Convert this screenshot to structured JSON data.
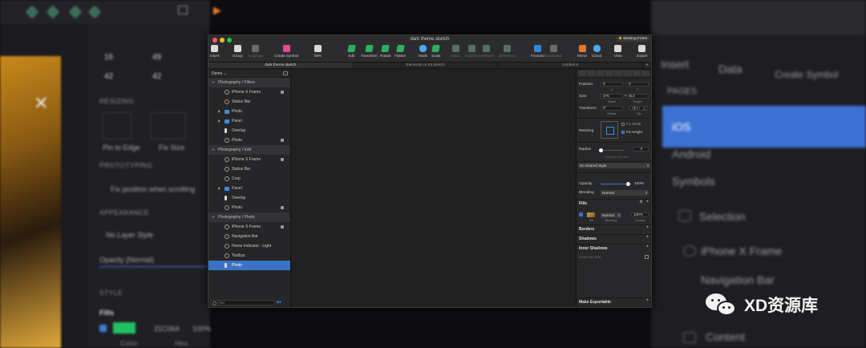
{
  "background_left": {
    "position_x": "16",
    "position_y": "49",
    "size_w": "42",
    "size_h": "42",
    "resizing_label": "RESIZING",
    "pin_to_edge": "Pin to Edge",
    "fix_size": "Fix Size",
    "prototyping_label": "PROTOTYPING",
    "fix_position": "Fix position when scrolling",
    "appearance_label": "APPEARANCE",
    "no_layer_style": "No Layer Style",
    "opacity_label": "Opacity (Normal)",
    "style_label": "STYLE",
    "fills_label": "Fills",
    "hex_value": "21C064",
    "opacity_value": "100%",
    "color_label": "Color",
    "hex_label": "Hex",
    "opacity_sub": "Opacity"
  },
  "background_right": {
    "insert": "Insert",
    "data": "Data",
    "create_symbol": "Create Symbol",
    "pages_label": "PAGES",
    "ios": "iOS",
    "android": "Android",
    "symbols": "Symbols",
    "selection": "Selection",
    "iphone_frame": "iPhone X Frame",
    "navigation_bar": "Navigation Bar",
    "content": "Content"
  },
  "watermark": "XD资源库",
  "window": {
    "title": "dark theme.sketch",
    "missing_fonts": "Missing Fonts",
    "toolbar": [
      {
        "label": "Insert",
        "icon": "plus-icon",
        "dim": false
      },
      {
        "label": "Group",
        "icon": "group-icon",
        "dim": false
      },
      {
        "label": "Ungroup",
        "icon": "ungroup-icon",
        "dim": true
      },
      {
        "label": "Create Symbol",
        "icon": "symbol-icon",
        "dim": false
      },
      {
        "label": "59%",
        "icon": "zoom-icon",
        "dim": false
      },
      {
        "label": "Edit",
        "icon": "edit-icon",
        "dim": false
      },
      {
        "label": "Transform",
        "icon": "transform-icon",
        "dim": false
      },
      {
        "label": "Rotate",
        "icon": "rotate-icon",
        "dim": false
      },
      {
        "label": "Flatten",
        "icon": "flatten-icon",
        "dim": false
      },
      {
        "label": "Mask",
        "icon": "mask-icon",
        "dim": false
      },
      {
        "label": "Scale",
        "icon": "scale-icon",
        "dim": false
      },
      {
        "label": "Union",
        "icon": "union-icon",
        "dim": true
      },
      {
        "label": "Subtract",
        "icon": "subtract-icon",
        "dim": true
      },
      {
        "label": "Intersect",
        "icon": "intersect-icon",
        "dim": true
      },
      {
        "label": "Difference",
        "icon": "difference-icon",
        "dim": true
      },
      {
        "label": "Forward",
        "icon": "forward-icon",
        "dim": false
      },
      {
        "label": "Backward",
        "icon": "backward-icon",
        "dim": true
      },
      {
        "label": "Mirror",
        "icon": "mirror-icon",
        "dim": false
      },
      {
        "label": "Cloud",
        "icon": "cloud-icon",
        "dim": false
      },
      {
        "label": "View",
        "icon": "view-icon",
        "dim": false
      },
      {
        "label": "Export",
        "icon": "export-icon",
        "dim": false
      }
    ],
    "tabs": [
      {
        "label": "dark theme.sketch",
        "active": true
      },
      {
        "label": "Elements UI Kit.sketch",
        "active": false
      },
      {
        "label": "Untitled 6",
        "active": false
      }
    ],
    "page_selector": "Demo",
    "layers": [
      {
        "type": "group",
        "label": "Photography / Filters"
      },
      {
        "type": "item",
        "icon": "sym",
        "label": "iPhone X Frame",
        "locked": true
      },
      {
        "type": "item",
        "icon": "sym",
        "label": "Status Bar",
        "locked": false
      },
      {
        "type": "item",
        "icon": "fold",
        "label": "Photo",
        "locked": false,
        "arrow": true
      },
      {
        "type": "item",
        "icon": "fold",
        "label": "Panel",
        "locked": false,
        "arrow": true
      },
      {
        "type": "item",
        "icon": "rect",
        "label": "Overlay",
        "locked": false
      },
      {
        "type": "item",
        "icon": "sym",
        "label": "Photo",
        "locked": true
      },
      {
        "type": "group",
        "label": "Photography / Edit"
      },
      {
        "type": "item",
        "icon": "sym",
        "label": "iPhone X Frame",
        "locked": true
      },
      {
        "type": "item",
        "icon": "sym",
        "label": "Status Bar",
        "locked": false
      },
      {
        "type": "item",
        "icon": "sym",
        "label": "Crop",
        "locked": false
      },
      {
        "type": "item",
        "icon": "fold",
        "label": "Panel",
        "locked": false,
        "arrow": true
      },
      {
        "type": "item",
        "icon": "rect",
        "label": "Overlay",
        "locked": false
      },
      {
        "type": "item",
        "icon": "sym",
        "label": "Photo",
        "locked": true
      },
      {
        "type": "group",
        "label": "Photography / Photo"
      },
      {
        "type": "item",
        "icon": "sym",
        "label": "iPhone X Frame",
        "locked": true
      },
      {
        "type": "item",
        "icon": "sym",
        "label": "Navigation Bar",
        "locked": false
      },
      {
        "type": "item",
        "icon": "sym",
        "label": "Home Indicator - Light",
        "locked": false
      },
      {
        "type": "item",
        "icon": "sym",
        "label": "Toolbar",
        "locked": false
      },
      {
        "type": "item",
        "icon": "rect",
        "label": "Photo",
        "locked": false,
        "selected": true
      }
    ],
    "filter_placeholder": "Filter",
    "inspector": {
      "position_label": "Position",
      "x": "0",
      "y": "0",
      "x_sub": "X",
      "y_sub": "Y",
      "size_label": "Size",
      "width": "375",
      "height": "812",
      "width_sub": "Width",
      "height_sub": "Height",
      "transform_label": "Transform",
      "rotate_value": "0°",
      "rotate_sub": "Rotate",
      "flip_sub": "Flip",
      "resizing_label": "Resizing",
      "fix_width": "Fix Width",
      "fix_height": "Fix Height",
      "radius_label": "Radius",
      "radius_value": "0",
      "smooth_corners": "Smooth Corners",
      "shared_style": "No Shared Style",
      "opacity_label": "Opacity",
      "opacity_value": "100%",
      "blending_label": "Blending",
      "blending_value": "Normal",
      "fills_label": "Fills",
      "fill_sub": "Fill",
      "fill_blending": "Normal",
      "fill_blending_sub": "Blending",
      "fill_opacity": "100%",
      "fill_opacity_sub": "Opacity",
      "borders_label": "Borders",
      "shadows_label": "Shadows",
      "inner_shadows_label": "Inner Shadows",
      "gaussian_blur": "Gaussian Blur",
      "make_exportable": "Make Exportable"
    }
  }
}
